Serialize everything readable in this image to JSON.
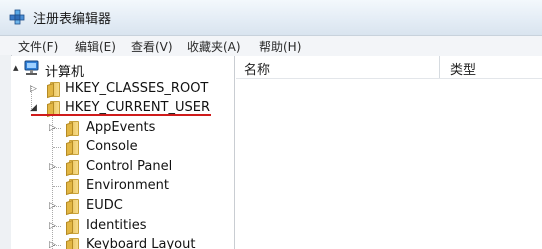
{
  "window": {
    "title": "注册表编辑器",
    "icon": "registry-editor-icon"
  },
  "menu": {
    "items": [
      {
        "label": "文件(F)"
      },
      {
        "label": "编辑(E)"
      },
      {
        "label": "查看(V)"
      },
      {
        "label": "收藏夹(A)"
      },
      {
        "label": "帮助(H)"
      }
    ]
  },
  "tree": {
    "root_label": "计算机",
    "hkcr": "HKEY_CLASSES_ROOT",
    "hkcu": "HKEY_CURRENT_USER",
    "children": [
      {
        "label": "AppEvents"
      },
      {
        "label": "Console"
      },
      {
        "label": "Control Panel"
      },
      {
        "label": "Environment"
      },
      {
        "label": "EUDC"
      },
      {
        "label": "Identities"
      },
      {
        "label": "Keyboard Layout"
      }
    ]
  },
  "list": {
    "columns": [
      {
        "label": "名称"
      },
      {
        "label": "类型"
      }
    ]
  },
  "colors": {
    "highlight_underline": "#cf1b1b"
  }
}
